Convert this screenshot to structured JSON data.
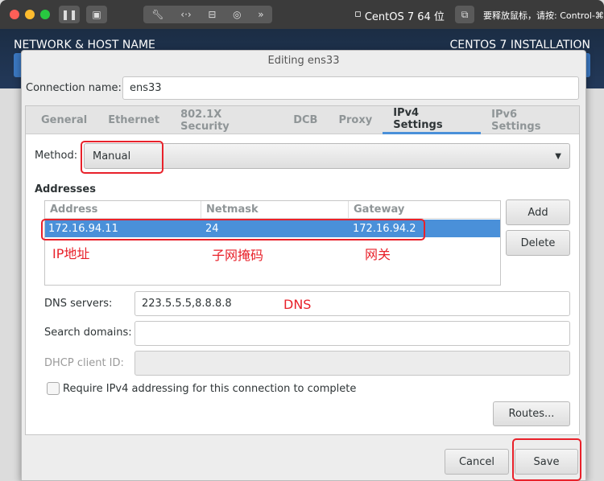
{
  "vm_toolbar": {
    "vm_name": "CentOS 7 64 位",
    "hint": "要释放鼠标，请按: Control-⌘",
    "buttons": [
      "pause",
      "snapshot",
      "settings",
      "network",
      "disk",
      "camera",
      "more"
    ]
  },
  "installer": {
    "left_title": "NETWORK & HOST NAME",
    "right_title": "CENTOS 7 INSTALLATION"
  },
  "dialog": {
    "title": "Editing ens33",
    "connection_name_label": "Connection name:",
    "connection_name_value": "ens33",
    "tabs": [
      {
        "label": "General"
      },
      {
        "label": "Ethernet"
      },
      {
        "label": "802.1X Security"
      },
      {
        "label": "DCB"
      },
      {
        "label": "Proxy"
      },
      {
        "label": "IPv4 Settings",
        "active": true
      },
      {
        "label": "IPv6 Settings"
      }
    ],
    "method_label": "Method:",
    "method_value": "Manual",
    "addresses_label": "Addresses",
    "columns": [
      "Address",
      "Netmask",
      "Gateway"
    ],
    "rows": [
      {
        "address": "172.16.94.11",
        "netmask": "24",
        "gateway": "172.16.94.2",
        "selected": true
      }
    ],
    "add_label": "Add",
    "delete_label": "Delete",
    "dns_label": "DNS servers:",
    "dns_value": "223.5.5.5,8.8.8.8",
    "search_label": "Search domains:",
    "search_value": "",
    "dhcp_label": "DHCP client ID:",
    "dhcp_value": "",
    "require_label": "Require IPv4 addressing for this connection to complete",
    "require_checked": false,
    "routes_label": "Routes...",
    "cancel_label": "Cancel",
    "save_label": "Save"
  },
  "annotations": {
    "ip": "IP地址",
    "netmask": "子网掩码",
    "gateway": "网关",
    "dns": "DNS",
    "color": "#e8212a"
  },
  "colors": {
    "accent": "#4a90d9"
  }
}
